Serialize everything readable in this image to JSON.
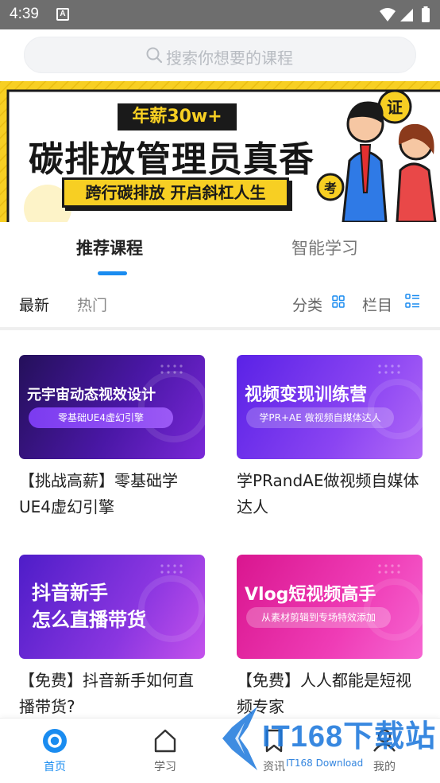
{
  "status_bar": {
    "time": "4:39",
    "notification_badge": "A"
  },
  "search": {
    "placeholder": "搜索你想要的课程"
  },
  "banner": {
    "badge": "年薪30w+",
    "headline": "碳排放管理员真香",
    "sub": "跨行碳排放 开启斜杠人生"
  },
  "tabs": [
    {
      "label": "推荐课程",
      "active": true
    },
    {
      "label": "智能学习",
      "active": false
    }
  ],
  "filter": {
    "latest": "最新",
    "hot": "热门",
    "category": "分类",
    "column": "栏目"
  },
  "courses": [
    {
      "thumb_title": "元宇宙动态视效设计",
      "thumb_pill": "零基础UE4虚幻引擎",
      "title": "【挑战高薪】零基础学UE4虚幻引擎",
      "colors": [
        "#2b1065",
        "#6b20c9"
      ]
    },
    {
      "thumb_title": "视频变现训练营",
      "thumb_pill": "学PR+AE 做视频自媒体达人",
      "title": "学PRandAE做视频自媒体达人",
      "colors": [
        "#6a2cf0",
        "#a55cf7"
      ]
    },
    {
      "thumb_title_line1": "抖音新手",
      "thumb_title_line2": "怎么直播带货",
      "title": "【免费】抖音新手如何直播带货?",
      "colors": [
        "#5b1fd0",
        "#b347e8"
      ]
    },
    {
      "thumb_title": "Vlog短视频高手",
      "thumb_pill": "从素材剪辑到专场特效添加",
      "title": "【免费】人人都能是短视频专家",
      "colors": [
        "#e01f9a",
        "#f250c4"
      ]
    }
  ],
  "bottom_nav": [
    {
      "label": "首页",
      "icon": "home-target-icon",
      "active": true
    },
    {
      "label": "学习",
      "icon": "house-outline-icon",
      "active": false
    },
    {
      "label": "资讯",
      "icon": "bookmark-icon",
      "active": false
    },
    {
      "label": "我的",
      "icon": "user-icon",
      "active": false
    }
  ],
  "watermark": {
    "brand": "IT168下载站",
    "sub": "IT168 Download"
  },
  "colors": {
    "accent": "#1a8cf0",
    "banner": "#f7cf23"
  }
}
